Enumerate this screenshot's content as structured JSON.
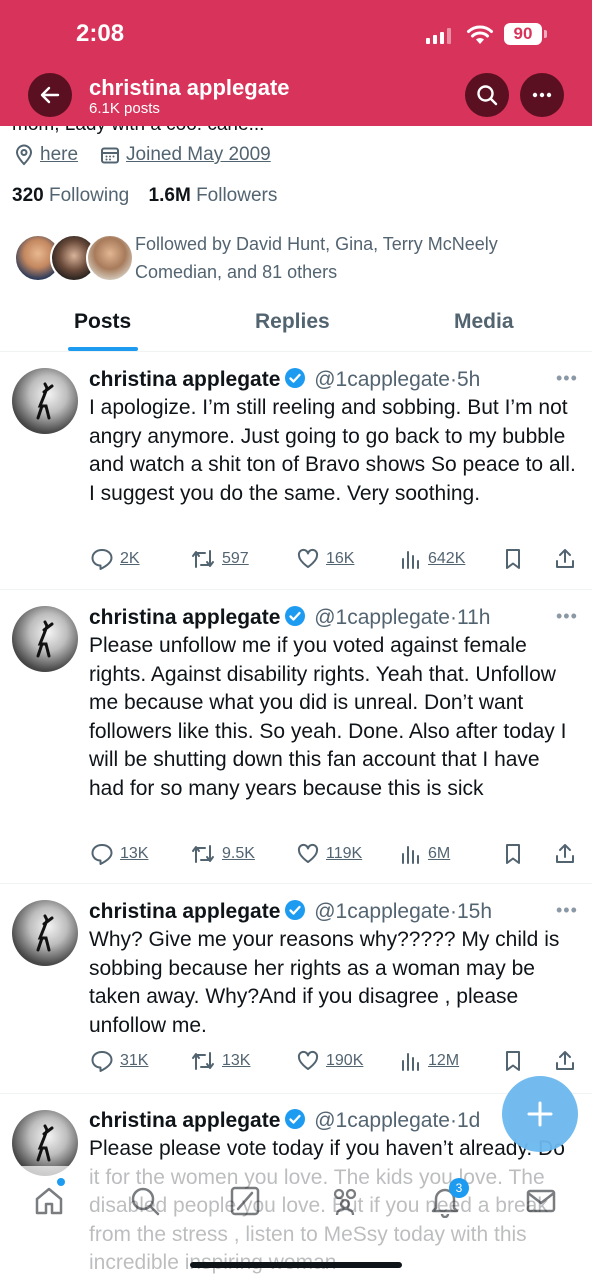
{
  "status_bar": {
    "time": "2:08",
    "battery": "90"
  },
  "header": {
    "name": "christina applegate",
    "posts_count": "6.1K posts"
  },
  "profile": {
    "bio_cut_text": "mom, Lady with a coo. cane...",
    "location": "here",
    "joined": "Joined May 2009",
    "following_count": "320",
    "following_label": "Following",
    "followers_count": "1.6M",
    "followers_label": "Followers",
    "followed_by": "Followed by David Hunt, Gina, Terry McNeely Comedian, and 81 others"
  },
  "tabs": [
    {
      "label": "Posts"
    },
    {
      "label": "Replies"
    },
    {
      "label": "Media"
    }
  ],
  "posts": [
    {
      "name": "christina applegate",
      "handle": "@1capplegate",
      "time": "5h",
      "text": "I apologize. I’m still reeling and sobbing. But I’m not angry anymore. Just going to go back to my bubble and watch a shit ton of Bravo shows   So peace to all. I suggest you do the same. Very soothing.",
      "replies": "2K",
      "reposts": "597",
      "likes": "16K",
      "views": "642K"
    },
    {
      "name": "christina applegate",
      "handle": "@1capplegate",
      "time": "11h",
      "text": "Please unfollow me if you voted against female rights. Against disability rights. Yeah that. Unfollow me because what you did is unreal. Don’t want followers like this. So yeah. Done. Also after today I will be shutting down this fan account that I have had for so many years because this is sick",
      "replies": "13K",
      "reposts": "9.5K",
      "likes": "119K",
      "views": "6M"
    },
    {
      "name": "christina applegate",
      "handle": "@1capplegate",
      "time": "15h",
      "text": "Why? Give me your reasons why????? My child is sobbing because her rights as a woman may be taken away. Why?And if you disagree , please unfollow me.",
      "replies": "31K",
      "reposts": "13K",
      "likes": "190K",
      "views": "12M"
    },
    {
      "name": "christina applegate",
      "handle": "@1capplegate",
      "time": "1d",
      "text": "Please please vote today if you haven’t already. Do it for the women you love. The kids you love. The disabled people you love. But if you need a break from the stress , listen to MeSsy today with this incredible inspiring woman"
    }
  ],
  "notification_badge": "3",
  "colors": {
    "header_bg": "#d8345b",
    "accent": "#1d9bf0",
    "verified": "#1d9bf0"
  }
}
